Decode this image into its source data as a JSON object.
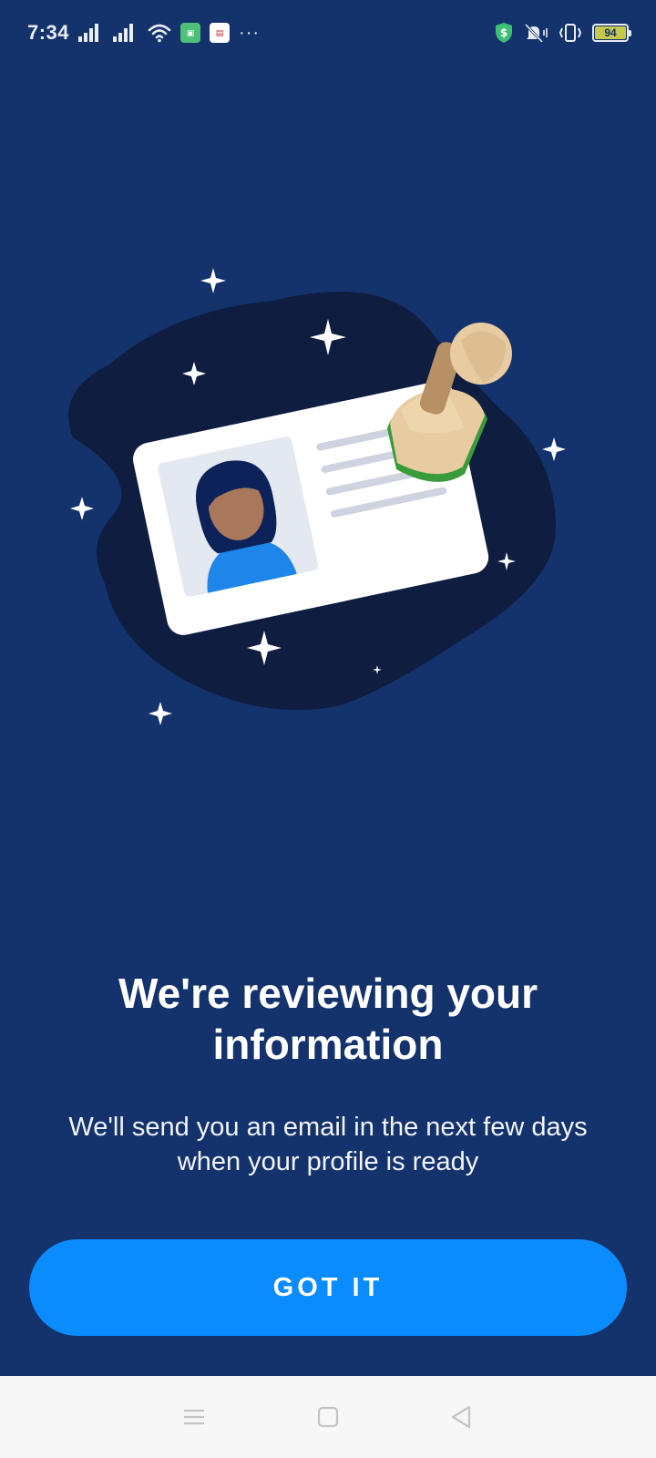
{
  "status_bar": {
    "time": "7:34",
    "battery_level": "94",
    "icons": [
      "signal-icon",
      "signal-icon",
      "wifi-icon",
      "app-notification-icon",
      "app-notification-icon",
      "more-icon",
      "shield-dollar-icon",
      "mute-icon",
      "vibrate-icon",
      "battery-icon"
    ]
  },
  "illustration": {
    "description_icons": [
      "id-card-icon",
      "rubber-stamp-icon",
      "sparkle-icon"
    ]
  },
  "content": {
    "title": "We're reviewing your information",
    "subtitle": "We'll send you an email in the next few days when your profile is ready"
  },
  "actions": {
    "primary_label": "GOT IT"
  },
  "nav_bar": {
    "buttons": [
      "menu-icon",
      "home-icon",
      "back-icon"
    ]
  },
  "colors": {
    "background": "#14326b",
    "blob": "#0e1d40",
    "button": "#0a8cff",
    "card": "#ffffff",
    "nav_bar": "#f7f7f7"
  }
}
